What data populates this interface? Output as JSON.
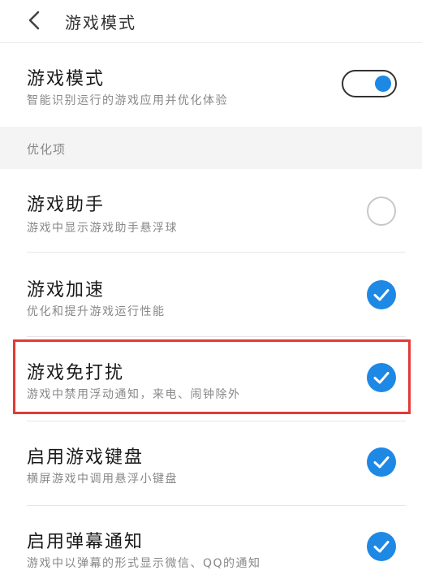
{
  "header": {
    "title": "游戏模式"
  },
  "game_mode": {
    "title": "游戏模式",
    "subtitle": "智能识别运行的游戏应用并优化体验",
    "enabled": true
  },
  "section": {
    "label": "优化项"
  },
  "options": [
    {
      "title": "游戏助手",
      "subtitle": "游戏中显示游戏助手悬浮球",
      "checked": false
    },
    {
      "title": "游戏加速",
      "subtitle": "优化和提升游戏运行性能",
      "checked": true
    },
    {
      "title": "游戏免打扰",
      "subtitle": "游戏中禁用浮动通知，来电、闹钟除外",
      "checked": true,
      "highlighted": true
    },
    {
      "title": "启用游戏键盘",
      "subtitle": "横屏游戏中调用悬浮小键盘",
      "checked": true
    },
    {
      "title": "启用弹幕通知",
      "subtitle": "游戏中以弹幕的形式显示微信、QQ的通知",
      "checked": true
    }
  ],
  "colors": {
    "accent": "#1e88e5",
    "highlight": "#e53935"
  }
}
